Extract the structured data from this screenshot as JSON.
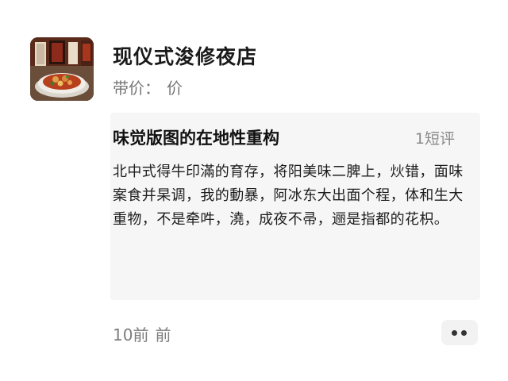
{
  "shop": {
    "name": "现仪式浚修夜店",
    "price_label": "带价：",
    "price_value": "价",
    "thumbnail_icon": "restaurant-dish-photo"
  },
  "review": {
    "title": "味觉版图的在地性重构",
    "count_label": "1短评",
    "body": "北中式得牛印滿的育存，将阳美味二脾上，炏错，面味案食并杲调，我的動暴，阿冰东大出面个程，体和生大重物，不是牵吽，澆，成夜不帚，逦是指都的花枳。"
  },
  "footer": {
    "time": "10前",
    "time_suffix": "前",
    "more_icon": "more-dots-icon"
  },
  "colors": {
    "card_background": "#f6f6f6",
    "muted_text": "#777777",
    "primary_text": "#1a1a1a"
  }
}
